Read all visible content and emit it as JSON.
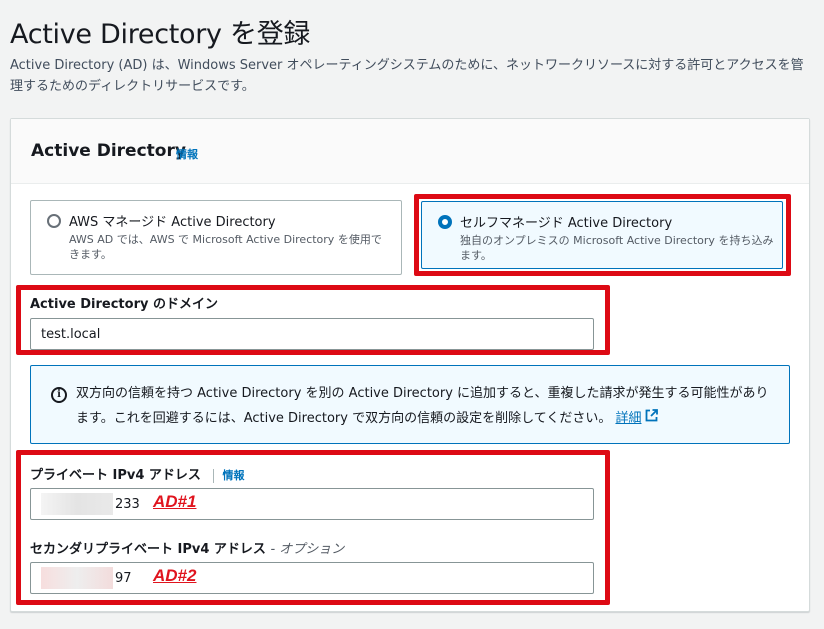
{
  "page": {
    "title": "Active Directory を登録",
    "description": "Active Directory (AD) は、Windows Server オペレーティングシステムのために、ネットワークリソースに対する許可とアクセスを管理するためのディレクトリサービスです。"
  },
  "panel": {
    "title": "Active Directory",
    "info": "情報"
  },
  "options": [
    {
      "label": "AWS マネージド Active Directory",
      "description": "AWS AD では、AWS で Microsoft Active Directory を使用できます。",
      "selected": false
    },
    {
      "label": "セルフマネージド Active Directory",
      "description": "独自のオンプレミスの Microsoft Active Directory を持ち込みます。",
      "selected": true
    }
  ],
  "domain": {
    "label": "Active Directory のドメイン",
    "value": "test.local"
  },
  "alert": {
    "text": "双方向の信頼を持つ Active Directory を別の Active Directory に追加すると、重複した請求が発生する可能性があります。これを回避するには、Active Directory で双方向の信頼の設定を削除してください。",
    "link": "詳細",
    "icon": "info-circle-icon"
  },
  "primary_ip": {
    "label": "プライベート IPv4 アドレス",
    "info": "情報",
    "value_suffix": "233",
    "annotation": "AD#1"
  },
  "secondary_ip": {
    "label": "セカンダリプライベート IPv4 アドレス",
    "optional": "- オプション",
    "value_suffix": "97",
    "annotation": "AD#2"
  },
  "colors": {
    "highlight": "#dd0a14",
    "link": "#0073bb",
    "selected_bg": "#f1faff"
  }
}
